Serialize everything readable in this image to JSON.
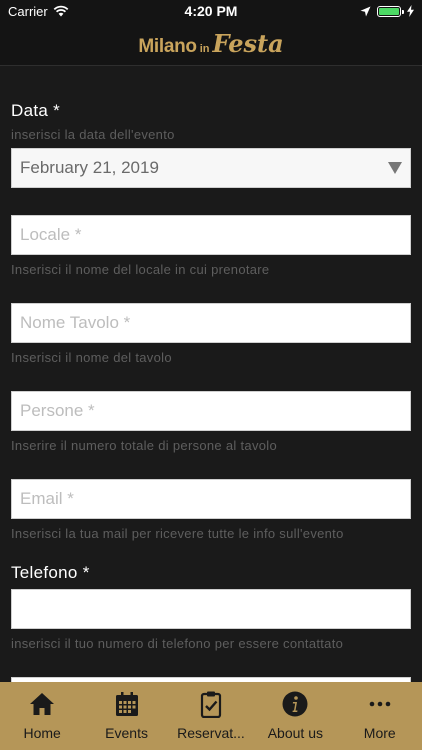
{
  "status_bar": {
    "carrier": "Carrier",
    "time": "4:20 PM"
  },
  "header": {
    "logo_main": "Milano",
    "logo_in": "in",
    "logo_script": "Festa"
  },
  "form": {
    "date": {
      "label": "Data *",
      "hint": "inserisci la data dell'evento",
      "value": "February 21, 2019"
    },
    "locale": {
      "placeholder": "Locale *",
      "hint": "Inserisci il nome del locale in cui prenotare"
    },
    "table_name": {
      "placeholder": "Nome Tavolo *",
      "hint": "Inserisci il nome del tavolo"
    },
    "people": {
      "placeholder": "Persone *",
      "hint": "Inserire il numero totale di persone al tavolo"
    },
    "email": {
      "placeholder": "Email *",
      "hint": "Inserisci la tua mail per ricevere tutte le info sull'evento"
    },
    "phone": {
      "label": "Telefono *",
      "value": "",
      "hint": "inserisci il tuo numero di telefono per essere contattato"
    }
  },
  "tab_bar": {
    "items": [
      {
        "label": "Home",
        "icon": "home-icon"
      },
      {
        "label": "Events",
        "icon": "calendar-icon"
      },
      {
        "label": "Reservat...",
        "icon": "clipboard-check-icon"
      },
      {
        "label": "About us",
        "icon": "info-icon"
      },
      {
        "label": "More",
        "icon": "more-dots-icon"
      }
    ]
  },
  "colors": {
    "accent": "#b59658",
    "logo": "#c9a45c",
    "background": "#1a1a1a",
    "hint_text": "#5e5e5e",
    "battery": "#4cd964"
  }
}
